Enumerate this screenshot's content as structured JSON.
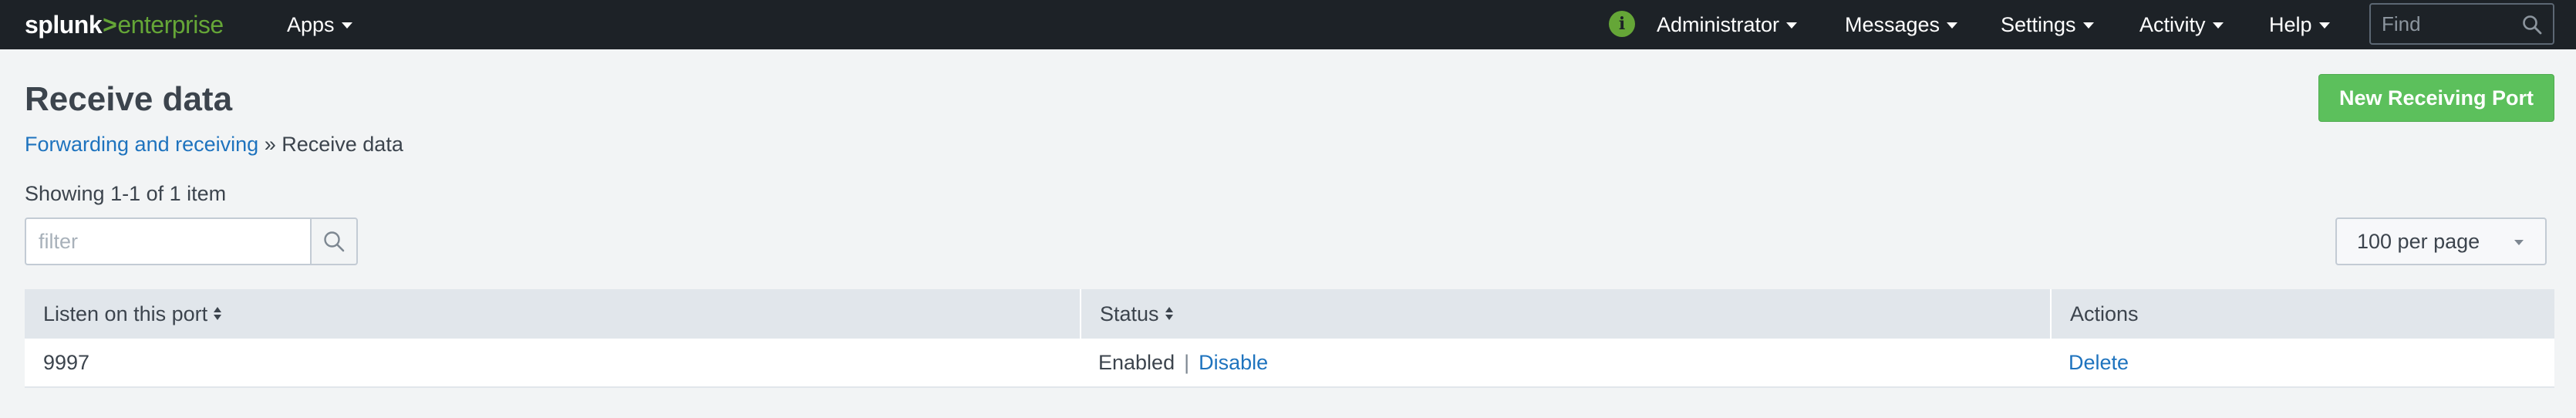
{
  "header": {
    "logo_main": "splunk",
    "logo_gt": ">",
    "logo_product": "enterprise",
    "apps_label": "Apps",
    "info_icon_glyph": "i",
    "nav": [
      {
        "label": "Administrator"
      },
      {
        "label": "Messages"
      },
      {
        "label": "Settings"
      },
      {
        "label": "Activity"
      },
      {
        "label": "Help"
      }
    ],
    "find_placeholder": "Find"
  },
  "page": {
    "title": "Receive data",
    "breadcrumb_link": "Forwarding and receiving",
    "breadcrumb_sep": "»",
    "breadcrumb_current": "Receive data",
    "new_button_label": "New Receiving Port",
    "showing_text": "Showing 1-1 of 1 item",
    "filter_placeholder": "filter",
    "per_page_label": "100 per page"
  },
  "table": {
    "columns": [
      "Listen on this port",
      "Status",
      "Actions"
    ],
    "rows": [
      {
        "port": "9997",
        "status": "Enabled",
        "pipe": "|",
        "toggle_action": "Disable",
        "delete_action": "Delete"
      }
    ]
  },
  "colors": {
    "topbar": "#1d2227",
    "brand_green": "#65a637",
    "primary_button": "#5cc05c",
    "link": "#1e73be"
  }
}
